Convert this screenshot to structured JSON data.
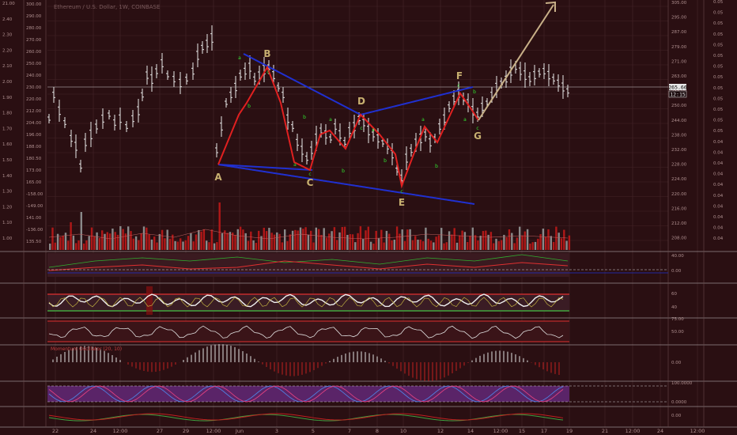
{
  "header": {
    "title": "Ethereum / U.S. Dollar, 1W, COINBASE"
  },
  "colors": {
    "background": "#2a0f12",
    "grid": "#4a2a2e",
    "bar": "#e8e8e8",
    "wave": "#e02020",
    "trend": "#2030d0",
    "arrow": "#c8b088",
    "wave_label": "#c8b070",
    "sub_label": "#30e030",
    "vol_red": "#b01818",
    "vol_grey": "#8a8a8a",
    "sub_purple": "#5a2468",
    "sub_line_white": "#f0f0f0",
    "sub_line_green": "#40c040",
    "sub_line_red": "#e03030"
  },
  "chart_data": {
    "type": "candlestick",
    "price_axis_right": [
      "305.00",
      "295.00",
      "287.00",
      "279.00",
      "271.00",
      "263.00",
      "255.00",
      "250.00",
      "244.00",
      "238.00",
      "232.00",
      "228.00",
      "224.00",
      "220.00",
      "216.00",
      "212.00",
      "208.00"
    ],
    "price_axis_left_inner": [
      "300.00",
      "290.00",
      "280.00",
      "270.00",
      "260.00",
      "250.00",
      "240.00",
      "230.00",
      "220.00",
      "212.00",
      "204.00",
      "196.00",
      "188.00",
      "180.50",
      "173.00",
      "165.00",
      "-158.00",
      "-149.00",
      "141.00",
      "-136.00",
      "135.50"
    ],
    "price_axis_left_outer": [
      "21.00",
      "2.40",
      "2.30",
      "2.20",
      "2.10",
      "2.00",
      "1.90",
      "1.80",
      "1.70",
      "1.60",
      "1.50",
      "1.40",
      "1.30",
      "1.20",
      "1.10",
      "1.00"
    ],
    "ratio_axis_far_right": [
      "0.05",
      "0.05",
      "0.05",
      "0.05",
      "0.05",
      "0.05",
      "0.05",
      "0.05",
      "0.05",
      "0.05",
      "0.05",
      "0.05",
      "0.05",
      "0.04",
      "0.04",
      "0.04",
      "0.04",
      "0.04",
      "0.04",
      "0.04",
      "0.04",
      "0.04",
      "0.04"
    ],
    "x_ticks": [
      "22",
      "24",
      "12:00",
      "27",
      "29",
      "12:00",
      "Jun",
      "3",
      "5",
      "7",
      "8",
      "10",
      "12",
      "14",
      "12:00",
      "15",
      "17",
      "19",
      "21",
      "12:00",
      "24",
      "12:00"
    ],
    "current_price": "265.66",
    "current_time": "12:15",
    "wave_points": [
      {
        "label": "A",
        "price": 233.5
      },
      {
        "label": "B",
        "price": 274.0
      },
      {
        "label": "C",
        "price": 231.0
      },
      {
        "label": "D",
        "price": 255.0
      },
      {
        "label": "E",
        "price": 226.0
      },
      {
        "label": "F",
        "price": 265.5
      },
      {
        "label": "G",
        "price": 252.0
      }
    ],
    "sub_wave_labels": [
      "a",
      "b",
      "c",
      "a",
      "b",
      "c",
      "a",
      "b",
      "c",
      "a",
      "b",
      "c",
      "a",
      "b",
      "c",
      "a",
      "b",
      "c"
    ],
    "panel_axes": {
      "macd": [
        "40.00",
        "0.00"
      ],
      "rsi": [
        "60",
        "40"
      ],
      "cci": [
        "75.00",
        "50.00"
      ],
      "histogram": [
        "0.00"
      ],
      "stoch": [
        "100.0000",
        "0.0000"
      ],
      "last": [
        "0.00"
      ]
    },
    "panel_titles": [
      "Momentum Oscillator (20, 10)"
    ]
  }
}
